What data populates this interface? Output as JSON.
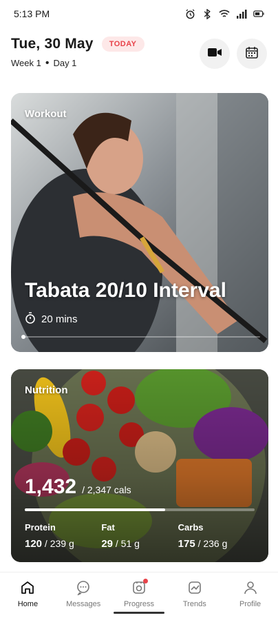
{
  "status_bar": {
    "time": "5:13 PM",
    "icons": [
      "alarm-icon",
      "bluetooth-icon",
      "wifi-icon",
      "signal-icon",
      "battery-icon"
    ]
  },
  "header": {
    "date": "Tue, 30 May",
    "badge": "TODAY",
    "week": "Week 1",
    "separator": "•",
    "day": "Day 1",
    "buttons": [
      "video-camera-icon",
      "calendar-icon"
    ]
  },
  "workout": {
    "label": "Workout",
    "title": "Tabata 20/10 Interval",
    "duration": "20 mins",
    "progress": 0.0,
    "accent": "#ffffff"
  },
  "nutrition": {
    "label": "Nutrition",
    "calories": "1,432",
    "calories_total": "/ 2,347 cals",
    "progress": 0.61,
    "macros": [
      {
        "name": "Protein",
        "value": "120",
        "total": "/ 239 g"
      },
      {
        "name": "Fat",
        "value": "29",
        "total": "/ 51 g"
      },
      {
        "name": "Carbs",
        "value": "175",
        "total": "/ 236 g"
      }
    ]
  },
  "nav": {
    "items": [
      {
        "label": "Home",
        "icon": "home-icon"
      },
      {
        "label": "Messages",
        "icon": "chat-icon"
      },
      {
        "label": "Progress",
        "icon": "progress-icon"
      },
      {
        "label": "Trends",
        "icon": "trends-icon"
      },
      {
        "label": "Profile",
        "icon": "profile-icon"
      }
    ],
    "active": "Home",
    "notification_color": "#e8434a"
  }
}
